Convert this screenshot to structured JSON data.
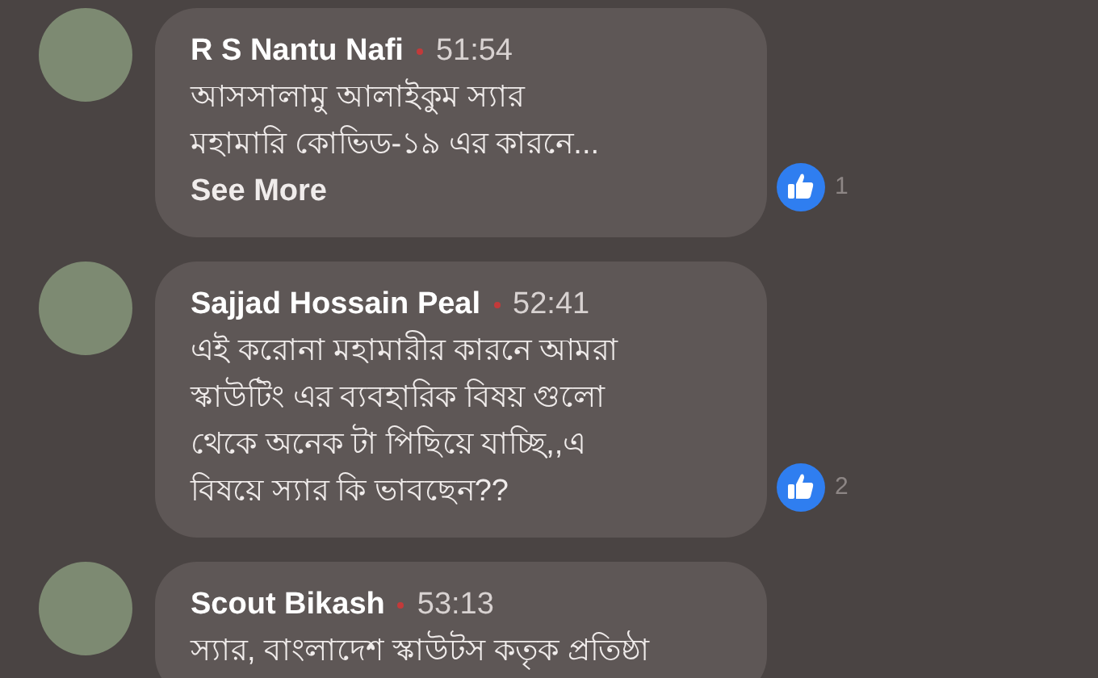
{
  "comments": [
    {
      "author": "R S Nantu Nafi",
      "time": "51:54",
      "lines": [
        "আসসালামু আলাইকুম স্যার",
        "মহামারি কোভিড-১৯ এর কারনে..."
      ],
      "see_more": "See More",
      "like_count": "1"
    },
    {
      "author": "Sajjad Hossain Peal",
      "time": "52:41",
      "lines": [
        "এই করোনা মহামারীর কারনে আমরা",
        "স্কাউটিং এর ব্যবহারিক বিষয় গুলো",
        "থেকে অনেক টা পিছিয়ে যাচ্ছি,,এ",
        "বিষয়ে স্যার কি ভাবছেন??"
      ],
      "like_count": "2"
    },
    {
      "author": "Scout Bikash",
      "time": "53:13",
      "lines": [
        "স্যার, বাংলাদেশ স্কাউটস কতৃক প্রতিষ্ঠা"
      ]
    }
  ]
}
